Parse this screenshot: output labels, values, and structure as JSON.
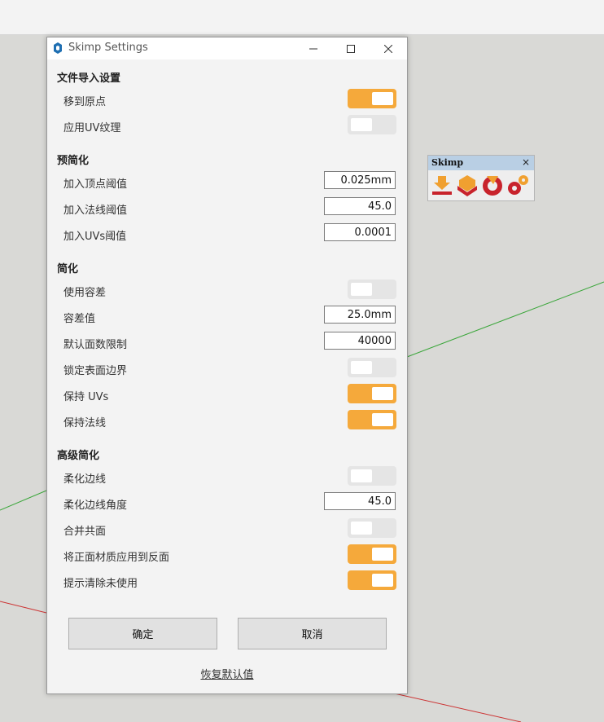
{
  "window": {
    "title": "Skimp Settings",
    "controls": [
      "minimize",
      "maximize",
      "close"
    ]
  },
  "sections": {
    "import": {
      "heading": "文件导入设置",
      "move_to_origin": {
        "label": "移到原点",
        "on": true
      },
      "apply_uv": {
        "label": "应用UV纹理",
        "on": false
      }
    },
    "pre_simplify": {
      "heading": "预简化",
      "vertex_threshold": {
        "label": "加入顶点阈值",
        "value": "0.025mm"
      },
      "normal_threshold": {
        "label": "加入法线阈值",
        "value": "45.0"
      },
      "uv_threshold": {
        "label": "加入UVs阈值",
        "value": "0.0001"
      }
    },
    "simplify": {
      "heading": "简化",
      "use_tolerance": {
        "label": "使用容差",
        "on": false
      },
      "tolerance": {
        "label": "容差值",
        "value": "25.0mm"
      },
      "face_limit": {
        "label": "默认面数限制",
        "value": "40000"
      },
      "lock_border": {
        "label": "锁定表面边界",
        "on": false
      },
      "keep_uvs": {
        "label": "保持 UVs",
        "on": true
      },
      "keep_normals": {
        "label": "保持法线",
        "on": true
      }
    },
    "advanced": {
      "heading": "高级简化",
      "soften_edges": {
        "label": "柔化边线",
        "on": false
      },
      "soften_angle": {
        "label": "柔化边线角度",
        "value": "45.0"
      },
      "merge_coplanar": {
        "label": "合并共面",
        "on": false
      },
      "front_to_back": {
        "label": "将正面材质应用到反面",
        "on": true
      },
      "purge_unused": {
        "label": "提示清除未使用",
        "on": true
      }
    }
  },
  "buttons": {
    "ok": "确定",
    "cancel": "取消",
    "reset": "恢复默认值"
  },
  "toolbar": {
    "title": "Skimp",
    "close": "×",
    "tools": [
      "import-icon",
      "simplify-icon",
      "help-icon",
      "settings-icon"
    ]
  },
  "colors": {
    "toggle_on": "#f5a93b",
    "toggle_off": "#e5e5e5"
  }
}
